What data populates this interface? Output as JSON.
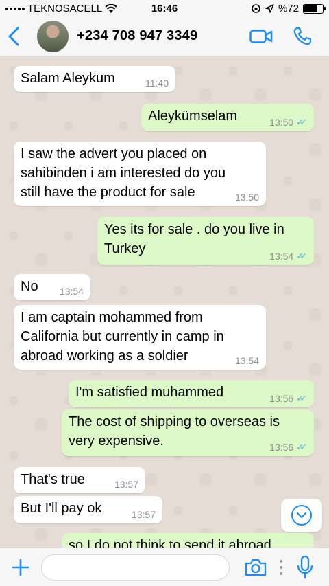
{
  "status_bar": {
    "carrier": "TEKNOSACELL",
    "time": "16:46",
    "battery": "%72",
    "battery_level": 0.72
  },
  "header": {
    "back_icon": "chevron-left-icon",
    "contact": "+234 708 947 3349",
    "video_icon": "video-camera-icon",
    "call_icon": "phone-icon"
  },
  "messages": [
    {
      "direction": "in",
      "text": "Salam Aleykum",
      "time": "11:40"
    },
    {
      "direction": "out",
      "text": "Aleykümselam",
      "time": "13:50",
      "read": true
    },
    {
      "direction": "in",
      "lines": [
        "I saw the advert you placed on",
        "sahibinden i am interested do you",
        "still have the product for sale"
      ],
      "time": "13:50"
    },
    {
      "direction": "out",
      "lines": [
        "Yes its for sale . do you live in",
        "Turkey"
      ],
      "time": "13:54",
      "read": true
    },
    {
      "direction": "in",
      "text": "No",
      "time": "13:54"
    },
    {
      "direction": "in",
      "lines": [
        "I am captain mohammed from",
        "California but currently in camp in",
        "abroad working as a soldier"
      ],
      "time": "13:54"
    },
    {
      "direction": "out",
      "text": "I'm satisfied muhammed",
      "time": "13:56",
      "read": true
    },
    {
      "direction": "out",
      "lines": [
        "The cost of shipping to overseas is",
        "very expensive."
      ],
      "time": "13:56",
      "read": true
    },
    {
      "direction": "in",
      "text": "That's true",
      "time": "13:57"
    },
    {
      "direction": "in",
      "text": "But I'll pay ok",
      "time": "13:57"
    },
    {
      "direction": "out",
      "text": "so I do not think to send it abroad",
      "time": "",
      "partial": true
    }
  ],
  "ticks": "✓✓",
  "input_bar": {
    "placeholder": "",
    "plus_icon": "plus-icon",
    "camera_icon": "camera-icon",
    "mic_icon": "microphone-icon"
  },
  "colors": {
    "accent": "#1a8cff",
    "incoming": "#ffffff",
    "outgoing": "#dcf8c6",
    "read_ticks": "#4fb6ec",
    "chat_bg": "#e5ddd5"
  }
}
